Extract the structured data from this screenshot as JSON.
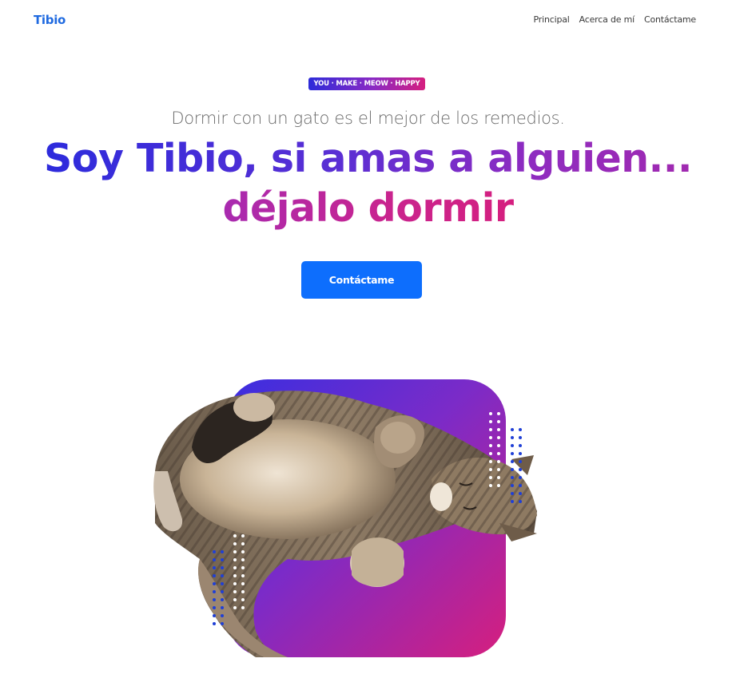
{
  "brand": {
    "name": "Tibio"
  },
  "nav": {
    "items": [
      {
        "label": "Principal"
      },
      {
        "label": "Acerca de mí"
      },
      {
        "label": "Contáctame"
      }
    ]
  },
  "hero": {
    "badge": "YOU · MAKE · MEOW · HAPPY",
    "subtitle": "Dormir con un gato es el mejor de los remedios.",
    "headline_line1": "Soy Tibio, si amas a alguien...",
    "headline_line2": "déjalo dormir",
    "cta_label": "Contáctame",
    "image": {
      "subject": "tabby cat lying on its back",
      "backdrop_gradient": [
        "#3a2ee0",
        "#7b2bc8",
        "#d61f7e"
      ],
      "dot_colors": [
        "#ffffff",
        "#1f3fd6"
      ]
    }
  },
  "colors": {
    "brand": "#1f6ae0",
    "button": "#0d6efd",
    "gradient_start": "#2d2bdc",
    "gradient_end": "#d51f7f"
  }
}
